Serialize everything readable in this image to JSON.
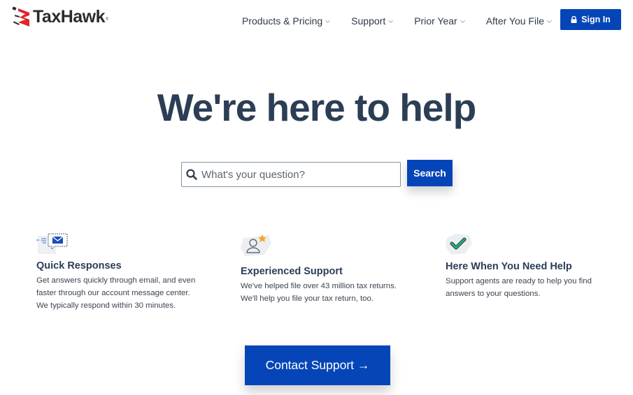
{
  "header": {
    "brand": "TaxHawk",
    "trademark": "®",
    "nav": [
      {
        "label": "Products & Pricing"
      },
      {
        "label": "Support"
      },
      {
        "label": "Prior Year"
      },
      {
        "label": "After You File"
      }
    ],
    "sign_in_label": "Sign In"
  },
  "hero": {
    "title": "We're here to help",
    "search_placeholder": "What's your question?",
    "search_value": "",
    "search_button": "Search"
  },
  "features": [
    {
      "icon": "envelope-chat-icon",
      "title": "Quick Responses",
      "text": "Get answers quickly through email, and even faster through our account message center. We typically respond within 30 minutes."
    },
    {
      "icon": "person-star-icon",
      "title": "Experienced Support",
      "text": "We've helped file over 43 million tax returns. We'll help you file your tax return, too."
    },
    {
      "icon": "checkmark-icon",
      "title": "Here When You Need Help",
      "text": "Support agents are ready to help you find answers to your questions."
    }
  ],
  "cta": {
    "label": "Contact Support →"
  },
  "colors": {
    "brand_blue": "#0645b8",
    "heading": "#2c3e55",
    "logo_red": "#e0262b",
    "check_green": "#1fa971",
    "star_orange": "#f5a623"
  }
}
